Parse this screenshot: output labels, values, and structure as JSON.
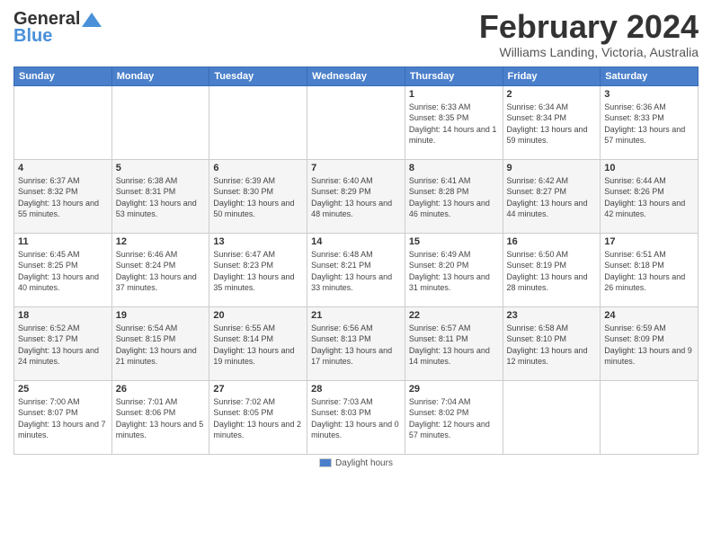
{
  "logo": {
    "line1": "General",
    "line2": "Blue"
  },
  "title": "February 2024",
  "subtitle": "Williams Landing, Victoria, Australia",
  "days_of_week": [
    "Sunday",
    "Monday",
    "Tuesday",
    "Wednesday",
    "Thursday",
    "Friday",
    "Saturday"
  ],
  "weeks": [
    [
      {
        "day": "",
        "info": ""
      },
      {
        "day": "",
        "info": ""
      },
      {
        "day": "",
        "info": ""
      },
      {
        "day": "",
        "info": ""
      },
      {
        "day": "1",
        "info": "Sunrise: 6:33 AM\nSunset: 8:35 PM\nDaylight: 14 hours and 1 minute."
      },
      {
        "day": "2",
        "info": "Sunrise: 6:34 AM\nSunset: 8:34 PM\nDaylight: 13 hours and 59 minutes."
      },
      {
        "day": "3",
        "info": "Sunrise: 6:36 AM\nSunset: 8:33 PM\nDaylight: 13 hours and 57 minutes."
      }
    ],
    [
      {
        "day": "4",
        "info": "Sunrise: 6:37 AM\nSunset: 8:32 PM\nDaylight: 13 hours and 55 minutes."
      },
      {
        "day": "5",
        "info": "Sunrise: 6:38 AM\nSunset: 8:31 PM\nDaylight: 13 hours and 53 minutes."
      },
      {
        "day": "6",
        "info": "Sunrise: 6:39 AM\nSunset: 8:30 PM\nDaylight: 13 hours and 50 minutes."
      },
      {
        "day": "7",
        "info": "Sunrise: 6:40 AM\nSunset: 8:29 PM\nDaylight: 13 hours and 48 minutes."
      },
      {
        "day": "8",
        "info": "Sunrise: 6:41 AM\nSunset: 8:28 PM\nDaylight: 13 hours and 46 minutes."
      },
      {
        "day": "9",
        "info": "Sunrise: 6:42 AM\nSunset: 8:27 PM\nDaylight: 13 hours and 44 minutes."
      },
      {
        "day": "10",
        "info": "Sunrise: 6:44 AM\nSunset: 8:26 PM\nDaylight: 13 hours and 42 minutes."
      }
    ],
    [
      {
        "day": "11",
        "info": "Sunrise: 6:45 AM\nSunset: 8:25 PM\nDaylight: 13 hours and 40 minutes."
      },
      {
        "day": "12",
        "info": "Sunrise: 6:46 AM\nSunset: 8:24 PM\nDaylight: 13 hours and 37 minutes."
      },
      {
        "day": "13",
        "info": "Sunrise: 6:47 AM\nSunset: 8:23 PM\nDaylight: 13 hours and 35 minutes."
      },
      {
        "day": "14",
        "info": "Sunrise: 6:48 AM\nSunset: 8:21 PM\nDaylight: 13 hours and 33 minutes."
      },
      {
        "day": "15",
        "info": "Sunrise: 6:49 AM\nSunset: 8:20 PM\nDaylight: 13 hours and 31 minutes."
      },
      {
        "day": "16",
        "info": "Sunrise: 6:50 AM\nSunset: 8:19 PM\nDaylight: 13 hours and 28 minutes."
      },
      {
        "day": "17",
        "info": "Sunrise: 6:51 AM\nSunset: 8:18 PM\nDaylight: 13 hours and 26 minutes."
      }
    ],
    [
      {
        "day": "18",
        "info": "Sunrise: 6:52 AM\nSunset: 8:17 PM\nDaylight: 13 hours and 24 minutes."
      },
      {
        "day": "19",
        "info": "Sunrise: 6:54 AM\nSunset: 8:15 PM\nDaylight: 13 hours and 21 minutes."
      },
      {
        "day": "20",
        "info": "Sunrise: 6:55 AM\nSunset: 8:14 PM\nDaylight: 13 hours and 19 minutes."
      },
      {
        "day": "21",
        "info": "Sunrise: 6:56 AM\nSunset: 8:13 PM\nDaylight: 13 hours and 17 minutes."
      },
      {
        "day": "22",
        "info": "Sunrise: 6:57 AM\nSunset: 8:11 PM\nDaylight: 13 hours and 14 minutes."
      },
      {
        "day": "23",
        "info": "Sunrise: 6:58 AM\nSunset: 8:10 PM\nDaylight: 13 hours and 12 minutes."
      },
      {
        "day": "24",
        "info": "Sunrise: 6:59 AM\nSunset: 8:09 PM\nDaylight: 13 hours and 9 minutes."
      }
    ],
    [
      {
        "day": "25",
        "info": "Sunrise: 7:00 AM\nSunset: 8:07 PM\nDaylight: 13 hours and 7 minutes."
      },
      {
        "day": "26",
        "info": "Sunrise: 7:01 AM\nSunset: 8:06 PM\nDaylight: 13 hours and 5 minutes."
      },
      {
        "day": "27",
        "info": "Sunrise: 7:02 AM\nSunset: 8:05 PM\nDaylight: 13 hours and 2 minutes."
      },
      {
        "day": "28",
        "info": "Sunrise: 7:03 AM\nSunset: 8:03 PM\nDaylight: 13 hours and 0 minutes."
      },
      {
        "day": "29",
        "info": "Sunrise: 7:04 AM\nSunset: 8:02 PM\nDaylight: 12 hours and 57 minutes."
      },
      {
        "day": "",
        "info": ""
      },
      {
        "day": "",
        "info": ""
      }
    ]
  ],
  "footer": {
    "legend_label": "Daylight hours"
  }
}
